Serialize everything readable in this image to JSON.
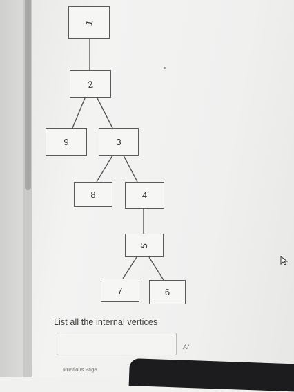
{
  "tree": {
    "nodes": {
      "n1": "1",
      "n2": "2",
      "n3": "3",
      "n4": "4",
      "n5": "5",
      "n6": "6",
      "n7": "7",
      "n8": "8",
      "n9": "9"
    }
  },
  "question": {
    "text": "List all the internal vertices",
    "answer_value": "",
    "spellcheck_icon": "A/"
  },
  "navigation": {
    "previous_label": "Previous Page"
  },
  "icons": {
    "cursor": "mouse-pointer-icon"
  }
}
